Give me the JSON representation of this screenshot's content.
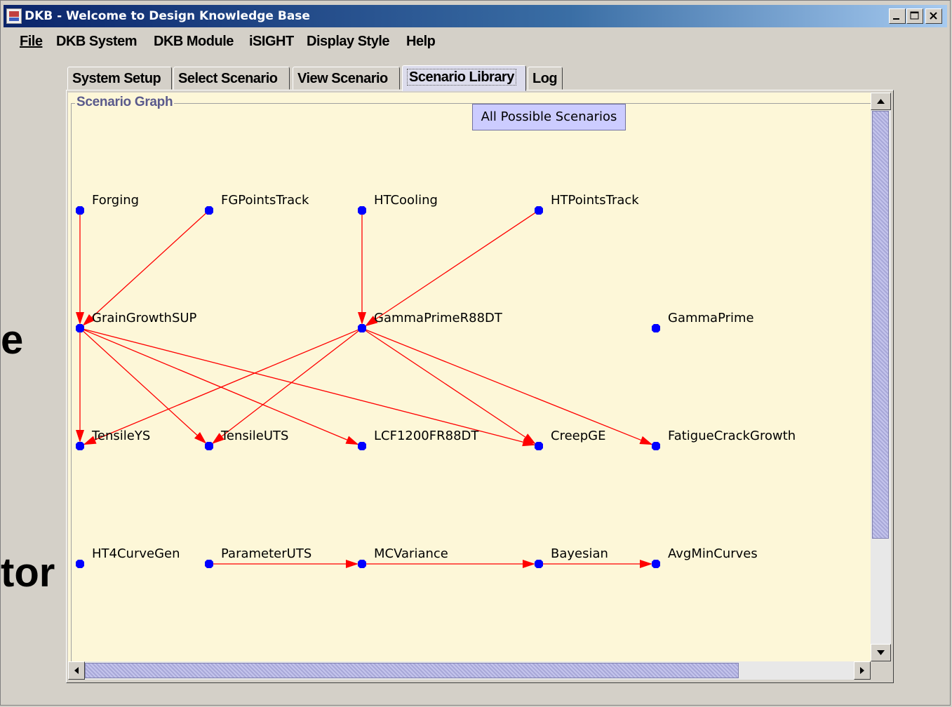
{
  "window": {
    "title": "DKB - Welcome to Design Knowledge Base"
  },
  "menu": {
    "file": "File",
    "dkb_system": "DKB System",
    "dkb_module": "DKB Module",
    "isight": "iSIGHT",
    "display_style": "Display Style",
    "help": "Help"
  },
  "tabs": {
    "system_setup": "System Setup",
    "select_scenario": "Select Scenario",
    "view_scenario": "View Scenario",
    "scenario_library": "Scenario Library",
    "log": "Log",
    "active": "Scenario Library"
  },
  "panel": {
    "group_title": "Scenario Graph",
    "scenarios_button": "All Possible Scenarios"
  },
  "overlay": {
    "fragment_1": "e",
    "fragment_2": "tor"
  },
  "graph": {
    "node_color": "#0000ff",
    "edge_color": "#ff0000",
    "nodes": [
      {
        "id": "forging",
        "label": "Forging"
      },
      {
        "id": "fgpointstrack",
        "label": "FGPointsTrack"
      },
      {
        "id": "htcooling",
        "label": "HTCooling"
      },
      {
        "id": "htpointstrack",
        "label": "HTPointsTrack"
      },
      {
        "id": "graingrowthsup",
        "label": "GrainGrowthSUP"
      },
      {
        "id": "gammaprimer88dt",
        "label": "GammaPrimeR88DT"
      },
      {
        "id": "gammaprime",
        "label": "GammaPrime"
      },
      {
        "id": "tensileys",
        "label": "TensileYS"
      },
      {
        "id": "tensileuts",
        "label": "TensileUTS"
      },
      {
        "id": "lcf1200fr88dt",
        "label": "LCF1200FR88DT"
      },
      {
        "id": "creepge",
        "label": "CreepGE"
      },
      {
        "id": "fatiguecrackgrowth",
        "label": "FatigueCrackGrowth"
      },
      {
        "id": "ht4curvegen",
        "label": "HT4CurveGen"
      },
      {
        "id": "parameteruts",
        "label": "ParameterUTS"
      },
      {
        "id": "mcvariance",
        "label": "MCVariance"
      },
      {
        "id": "bayesian",
        "label": "Bayesian"
      },
      {
        "id": "avgmincurves",
        "label": "AvgMinCurves"
      }
    ],
    "edges": [
      [
        "forging",
        "graingrowthsup"
      ],
      [
        "fgpointstrack",
        "graingrowthsup"
      ],
      [
        "htcooling",
        "gammaprimer88dt"
      ],
      [
        "htpointstrack",
        "gammaprimer88dt"
      ],
      [
        "graingrowthsup",
        "tensileys"
      ],
      [
        "graingrowthsup",
        "tensileuts"
      ],
      [
        "graingrowthsup",
        "lcf1200fr88dt"
      ],
      [
        "graingrowthsup",
        "creepge"
      ],
      [
        "gammaprimer88dt",
        "tensileys"
      ],
      [
        "gammaprimer88dt",
        "tensileuts"
      ],
      [
        "gammaprimer88dt",
        "creepge"
      ],
      [
        "gammaprimer88dt",
        "fatiguecrackgrowth"
      ],
      [
        "parameteruts",
        "mcvariance"
      ],
      [
        "mcvariance",
        "bayesian"
      ],
      [
        "bayesian",
        "avgmincurves"
      ]
    ]
  }
}
